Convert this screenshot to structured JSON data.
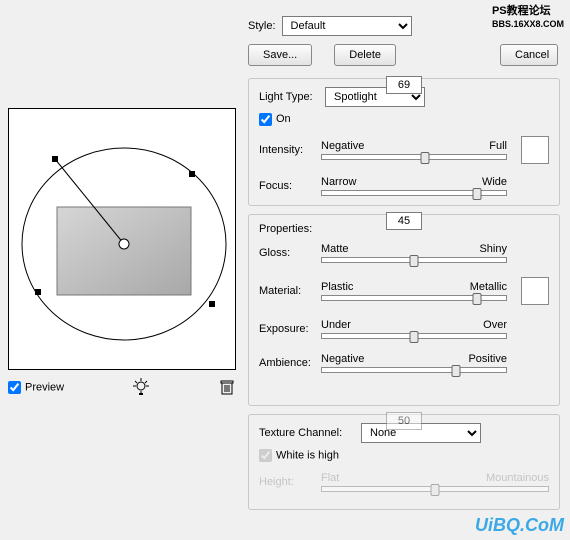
{
  "watermarks": {
    "top": "PS教程论坛",
    "top2": "BBS.16XX8.COM",
    "bottom": "UiBQ.CoM"
  },
  "style": {
    "label": "Style:",
    "value": "Default",
    "save": "Save...",
    "delete": "Delete",
    "cancel": "Cancel"
  },
  "light": {
    "type_label": "Light Type:",
    "type_value": "Spotlight",
    "on_label": "On",
    "intensity": {
      "label": "Intensity:",
      "left": "Negative",
      "right": "Full",
      "value": "12",
      "pct": 56
    },
    "focus": {
      "label": "Focus:",
      "left": "Narrow",
      "right": "Wide",
      "value": "69",
      "pct": 84
    }
  },
  "props": {
    "title": "Properties:",
    "gloss": {
      "label": "Gloss:",
      "left": "Matte",
      "right": "Shiny",
      "value": "0",
      "pct": 50
    },
    "material": {
      "label": "Material:",
      "left": "Plastic",
      "right": "Metallic",
      "value": "69",
      "pct": 84
    },
    "exposure": {
      "label": "Exposure:",
      "left": "Under",
      "right": "Over",
      "value": "0",
      "pct": 50
    },
    "ambience": {
      "label": "Ambience:",
      "left": "Negative",
      "right": "Positive",
      "value": "45",
      "pct": 73
    }
  },
  "texture": {
    "channel_label": "Texture Channel:",
    "channel_value": "None",
    "white_label": "White is high",
    "height": {
      "label": "Height:",
      "left": "Flat",
      "right": "Mountainous",
      "value": "50",
      "pct": 50
    }
  },
  "preview": {
    "label": "Preview"
  }
}
